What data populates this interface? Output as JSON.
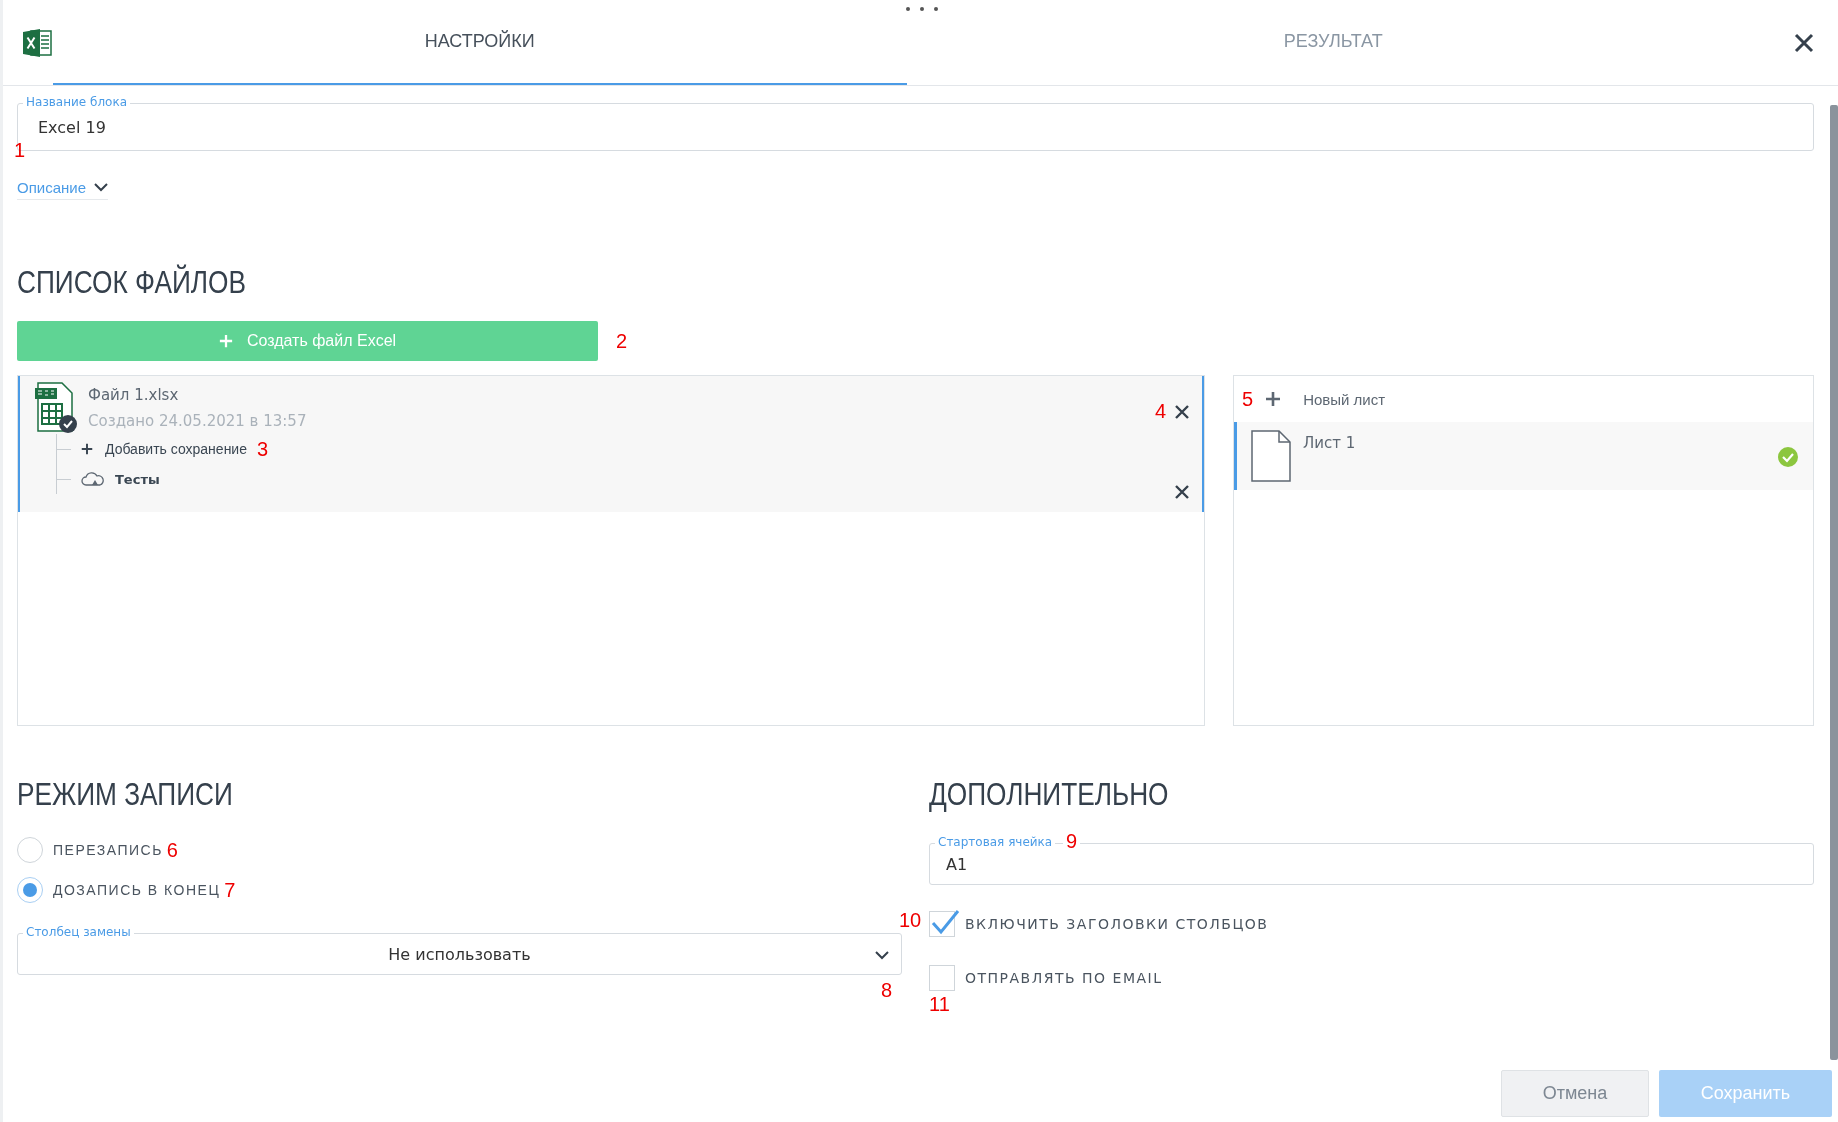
{
  "tabs": [
    {
      "label": "НАСТРОЙКИ",
      "selected": true
    },
    {
      "label": "РЕЗУЛЬТАТ",
      "selected": false
    }
  ],
  "name_field": {
    "label": "Название блока",
    "value": "Excel 19",
    "marker": "1"
  },
  "description_toggle": {
    "label": "Описание",
    "expanded": false
  },
  "files_section": {
    "heading": "СПИСОК ФАЙЛОВ",
    "create_button": "Создать файл Excel",
    "create_marker": "2",
    "files": [
      {
        "name": "Файл 1.xlsx",
        "created": "Создано 24.05.2021 в 13:57",
        "selected": true,
        "marker": "4",
        "add_save": "Добавить сохранение",
        "add_save_marker": "3",
        "saves": [
          {
            "name": "Тесты"
          }
        ]
      }
    ],
    "new_sheet": "Новый лист",
    "new_sheet_marker": "5",
    "sheets": [
      {
        "name": "Лист 1",
        "selected": true,
        "checked": true
      }
    ]
  },
  "write_mode": {
    "heading": "РЕЖИМ ЗАПИСИ",
    "options": [
      {
        "label": "ПЕРЕЗАПИСЬ",
        "selected": false,
        "marker": "6"
      },
      {
        "label": "ДОЗАПИСЬ В КОНЕЦ",
        "selected": true,
        "marker": "7"
      }
    ],
    "replace_column": {
      "label": "Столбец замены",
      "value": "Не использовать",
      "marker": "8"
    }
  },
  "extra": {
    "heading": "ДОПОЛНИТЕЛЬНО",
    "start_cell": {
      "label": "Стартовая ячейка",
      "value": "A1",
      "marker": "9"
    },
    "checkboxes": [
      {
        "label": "ВКЛЮЧИТЬ ЗАГОЛОВКИ СТОЛБЦОВ",
        "checked": true,
        "marker": "10"
      },
      {
        "label": "ОТПРАВЛЯТЬ ПО EMAIL",
        "checked": false,
        "marker": "11"
      }
    ]
  },
  "buttons": [
    {
      "label": "Отмена",
      "kind": "secondary"
    },
    {
      "label": "Сохранить",
      "kind": "primary"
    }
  ]
}
